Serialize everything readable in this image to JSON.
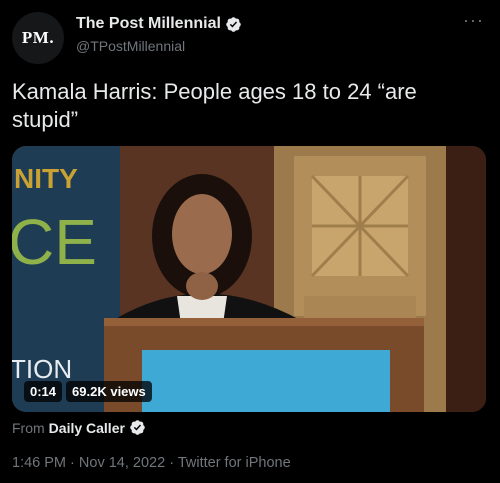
{
  "author": {
    "avatar_text": "PM.",
    "display_name": "The Post Millennial",
    "handle": "@TPostMillennial"
  },
  "tweet": {
    "text": "Kamala Harris: People ages 18 to 24 “are stupid”"
  },
  "video": {
    "duration": "0:14",
    "views": "69.2K views",
    "backdrop_text_1": "NITY",
    "backdrop_text_2": "CE",
    "backdrop_text_3": "TION"
  },
  "attribution": {
    "prefix": "From",
    "source": "Daily Caller"
  },
  "meta": {
    "time": "1:46 PM",
    "separator": "·",
    "date": "Nov 14, 2022",
    "client": "Twitter for iPhone"
  },
  "colors": {
    "background": "#000000",
    "text_primary": "#e7e9ea",
    "text_secondary": "#71767b",
    "verified": "#1d9bf0"
  },
  "icons": [
    "verified-badge-icon",
    "more-icon"
  ]
}
